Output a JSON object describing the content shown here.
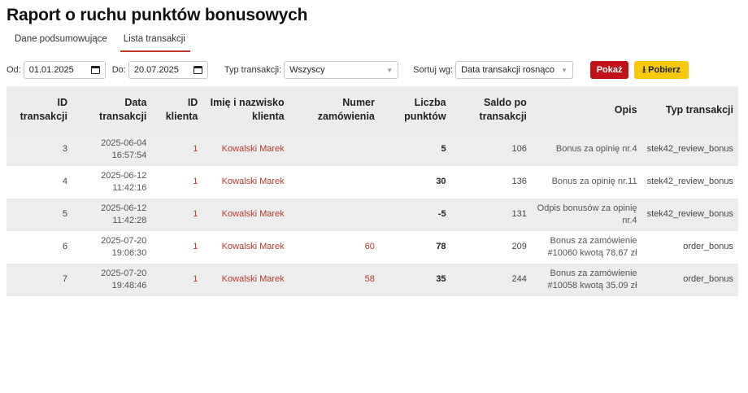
{
  "page": {
    "title": "Raport o ruchu punktów bonusowych"
  },
  "tabs": [
    {
      "label": "Dane podsumowujące",
      "active": false
    },
    {
      "label": "Lista transakcji",
      "active": true
    }
  ],
  "filters": {
    "from_label": "Od:",
    "from_value": "01.01.2025",
    "to_label": "Do:",
    "to_value": "20.07.2025",
    "type_label": "Typ transakcji:",
    "type_value": "Wszyscy",
    "sort_label": "Sortuj wg:",
    "sort_value": "Data transakcji rosnąco",
    "show_button": "Pokaż",
    "download_button": "Pobierz"
  },
  "colors": {
    "accent": "#c0121a",
    "download": "#f6c90e",
    "link": "#c0392b"
  },
  "table": {
    "headers": {
      "id": [
        "ID",
        "transakcji"
      ],
      "date": [
        "Data",
        "transakcji"
      ],
      "client_id": [
        "ID",
        "klienta"
      ],
      "name": [
        "Imię i nazwisko",
        "klienta"
      ],
      "order": [
        "Numer",
        "zamówienia"
      ],
      "points": [
        "Liczba",
        "punktów"
      ],
      "balance": [
        "Saldo po",
        "transakcji"
      ],
      "desc": [
        "Opis"
      ],
      "type": [
        "Typ transakcji"
      ]
    },
    "rows": [
      {
        "id": "3",
        "date": "2025-06-04",
        "time": "16:57:54",
        "client_id": "1",
        "name": "Kowalski Marek",
        "order": "",
        "points": "5",
        "balance": "106",
        "desc1": "Bonus za opinię nr.4",
        "desc2": "",
        "type": "stek42_review_bonus"
      },
      {
        "id": "4",
        "date": "2025-06-12",
        "time": "11:42:16",
        "client_id": "1",
        "name": "Kowalski Marek",
        "order": "",
        "points": "30",
        "balance": "136",
        "desc1": "Bonus za opinię nr.11",
        "desc2": "",
        "type": "stek42_review_bonus"
      },
      {
        "id": "5",
        "date": "2025-06-12",
        "time": "11:42:28",
        "client_id": "1",
        "name": "Kowalski Marek",
        "order": "",
        "points": "-5",
        "balance": "131",
        "desc1": "Odpis bonusów za opinię",
        "desc2": "nr.4",
        "type": "stek42_review_bonus"
      },
      {
        "id": "6",
        "date": "2025-07-20",
        "time": "19:06:30",
        "client_id": "1",
        "name": "Kowalski Marek",
        "order": "60",
        "points": "78",
        "balance": "209",
        "desc1": "Bonus za zamówienie",
        "desc2": "#10060 kwotą 78.67 zł",
        "type": "order_bonus"
      },
      {
        "id": "7",
        "date": "2025-07-20",
        "time": "19:48:46",
        "client_id": "1",
        "name": "Kowalski Marek",
        "order": "58",
        "points": "35",
        "balance": "244",
        "desc1": "Bonus za zamówienie",
        "desc2": "#10058 kwotą 35.09 zł",
        "type": "order_bonus"
      }
    ]
  }
}
